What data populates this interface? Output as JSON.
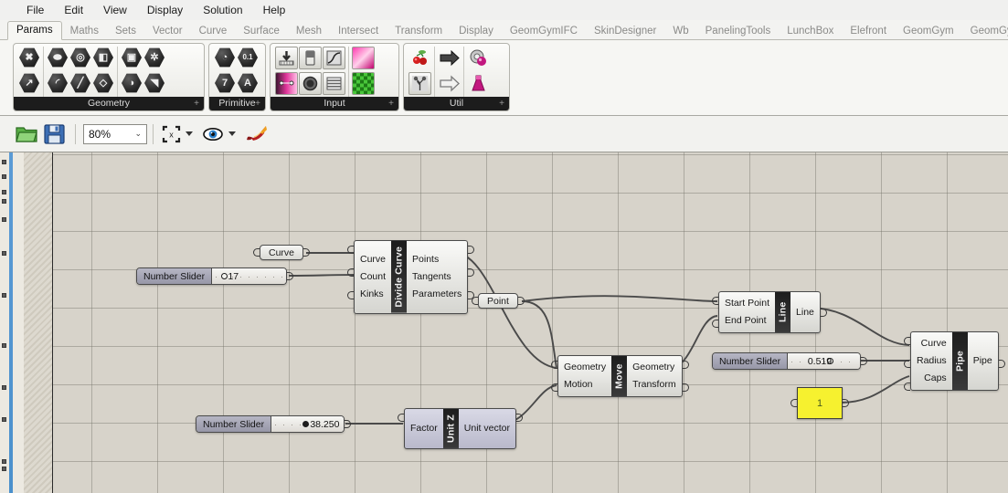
{
  "menu": {
    "items": [
      "File",
      "Edit",
      "View",
      "Display",
      "Solution",
      "Help"
    ]
  },
  "tabs": {
    "active": "Params",
    "items": [
      "Params",
      "Maths",
      "Sets",
      "Vector",
      "Curve",
      "Surface",
      "Mesh",
      "Intersect",
      "Transform",
      "Display",
      "GeomGymIFC",
      "SkinDesigner",
      "Wb",
      "PanelingTools",
      "LunchBox",
      "Elefront",
      "GeomGym",
      "GeomGymRvt"
    ]
  },
  "ribbon": {
    "groups": [
      {
        "name": "Geometry",
        "expand": "+",
        "subgroups": [
          {
            "cols": 1,
            "icons": [
              {
                "name": "geometry-param-icon",
                "glyph": "✖"
              },
              {
                "name": "vector-param-icon",
                "glyph": "↗"
              }
            ]
          },
          {
            "cols": 3,
            "icons": [
              {
                "name": "circle-param-icon",
                "glyph": "⬬"
              },
              {
                "name": "curve-param-icon",
                "glyph": "◎"
              },
              {
                "name": "surface-param-icon",
                "glyph": "◧"
              },
              {
                "name": "arc-param-icon",
                "glyph": "◜"
              },
              {
                "name": "line-param-icon",
                "glyph": "╱"
              },
              {
                "name": "mesh-face-param-icon",
                "glyph": "◇"
              }
            ]
          },
          {
            "cols": 2,
            "icons": [
              {
                "name": "box-param-icon",
                "glyph": "▣"
              },
              {
                "name": "mesh-param-icon",
                "glyph": "✲"
              },
              {
                "name": "brep-param-icon",
                "glyph": "◑"
              },
              {
                "name": "subd-param-icon",
                "glyph": "◥"
              }
            ]
          }
        ]
      },
      {
        "name": "Primitive",
        "expand": "+",
        "subgroups": [
          {
            "cols": 2,
            "icons": [
              {
                "name": "boolean-param-icon",
                "glyph": "◔"
              },
              {
                "name": "number-param-icon",
                "glyph": "0.1"
              },
              {
                "name": "integer-param-icon",
                "glyph": "7"
              },
              {
                "name": "text-param-icon",
                "glyph": "A"
              }
            ]
          }
        ]
      },
      {
        "name": "Input",
        "expand": "+",
        "subgroups": [
          {
            "cols": 3,
            "icons": [
              {
                "name": "number-slider-icon",
                "glyph": "⬇"
              },
              {
                "name": "boolean-toggle-icon",
                "glyph": "▫"
              },
              {
                "name": "graph-mapper-icon",
                "glyph": "⤳"
              },
              {
                "name": "gradient-icon",
                "glyph": "▬"
              },
              {
                "name": "button-icon",
                "glyph": "●"
              },
              {
                "name": "value-list-icon",
                "glyph": "☰"
              }
            ]
          },
          {
            "cols": 1,
            "icons": [
              {
                "name": "colour-swatch-icon",
                "glyph": "▒"
              },
              {
                "name": "colour-picker-icon",
                "glyph": "░"
              }
            ]
          }
        ]
      },
      {
        "name": "Util",
        "expand": "+",
        "subgroups": [
          {
            "cols": 1,
            "icons": [
              {
                "name": "cherry-picker-icon",
                "glyph": "❦"
              },
              {
                "name": "data-tree-icon",
                "glyph": "⚘"
              }
            ]
          },
          {
            "cols": 1,
            "icons": [
              {
                "name": "data-recorder-icon",
                "glyph": "➡"
              },
              {
                "name": "data-dam-icon",
                "glyph": "⇨"
              }
            ]
          },
          {
            "cols": 1,
            "icons": [
              {
                "name": "cluster-icon",
                "glyph": "◕"
              },
              {
                "name": "jitter-icon",
                "glyph": "⚗"
              }
            ]
          }
        ]
      }
    ]
  },
  "toolbar": {
    "open_label": "open-file",
    "save_label": "save-file",
    "zoom_value": "80%",
    "zoom_chevron": "⌄",
    "fit_label": "zoom-extents",
    "preview_label": "preview-toggle",
    "bake_label": "bake"
  },
  "canvas": {
    "nodes": {
      "curve_param": {
        "label": "Curve"
      },
      "point_param": {
        "label": "Point"
      },
      "divide_curve": {
        "title": "Divide Curve",
        "inputs": [
          "Curve",
          "Count",
          "Kinks"
        ],
        "outputs": [
          "Points",
          "Tangents",
          "Parameters"
        ]
      },
      "move": {
        "title": "Move",
        "inputs": [
          "Geometry",
          "Motion"
        ],
        "outputs": [
          "Geometry",
          "Transform"
        ]
      },
      "line": {
        "title": "Line",
        "inputs": [
          "Start Point",
          "End Point"
        ],
        "outputs": [
          "Line"
        ]
      },
      "pipe": {
        "title": "Pipe",
        "inputs": [
          "Curve",
          "Radius",
          "Caps"
        ],
        "outputs": [
          "Pipe"
        ]
      },
      "unit_z": {
        "title": "Unit Z",
        "inputs": [
          "Factor"
        ],
        "outputs": [
          "Unit vector"
        ]
      },
      "slider_count": {
        "label": "Number Slider",
        "value": "17",
        "grip_pct": 12
      },
      "slider_radius": {
        "label": "Number Slider",
        "value": "0.519",
        "grip_pct": 55
      },
      "slider_factor": {
        "label": "Number Slider",
        "value": "38.250",
        "grip_pct": 43
      },
      "panel": {
        "value": "1"
      }
    }
  },
  "colors": {
    "canvas_bg": "#d7d3ca",
    "panel_yellow": "#f6f12f",
    "panel_text": "#4b5c1d",
    "wire": "#4a4a4a",
    "accent_blue": "#5b9bd5"
  }
}
